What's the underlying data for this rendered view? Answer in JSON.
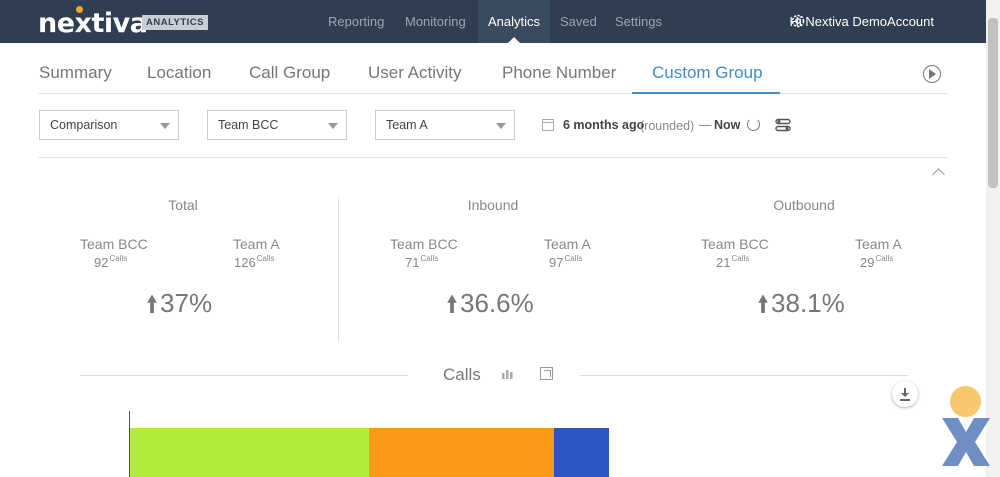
{
  "nav": {
    "logo": "nextiva",
    "logo_badge": "ANALYTICS",
    "items": [
      {
        "label": "Reporting"
      },
      {
        "label": "Monitoring"
      },
      {
        "label": "Analytics"
      },
      {
        "label": "Saved"
      },
      {
        "label": "Settings"
      }
    ],
    "active": "Analytics",
    "user_greeting": "Hi Nextiva DemoAccount"
  },
  "tabs": [
    {
      "label": "Summary"
    },
    {
      "label": "Location"
    },
    {
      "label": "Call Group"
    },
    {
      "label": "User Activity"
    },
    {
      "label": "Phone Number"
    },
    {
      "label": "Custom Group"
    }
  ],
  "active_tab": "Custom Group",
  "filters": {
    "mode": "Comparison",
    "group_a": "Team BCC",
    "group_b": "Team A",
    "date_from": "6 months ago",
    "date_modifier": "(rounded)",
    "date_separator": "—",
    "date_to": "Now"
  },
  "stats": [
    {
      "title": "Total",
      "a_name": "Team BCC",
      "a_value": "92",
      "b_name": "Team A",
      "b_value": "126",
      "unit": "Calls",
      "change": "37%"
    },
    {
      "title": "Inbound",
      "a_name": "Team BCC",
      "a_value": "71",
      "b_name": "Team A",
      "b_value": "97",
      "unit": "Calls",
      "change": "36.6%"
    },
    {
      "title": "Outbound",
      "a_name": "Team BCC",
      "a_value": "21",
      "b_name": "Team A",
      "b_value": "29",
      "unit": "Calls",
      "change": "38.1%"
    }
  ],
  "calls_section": {
    "title": "Calls"
  },
  "chart_colors": {
    "segment_1": "#b2eb3a",
    "segment_2": "#fb9a1a",
    "segment_3": "#2b56c4"
  },
  "colors": {
    "nav_bg": "#2f3e50",
    "accent": "#3f8ec7"
  }
}
